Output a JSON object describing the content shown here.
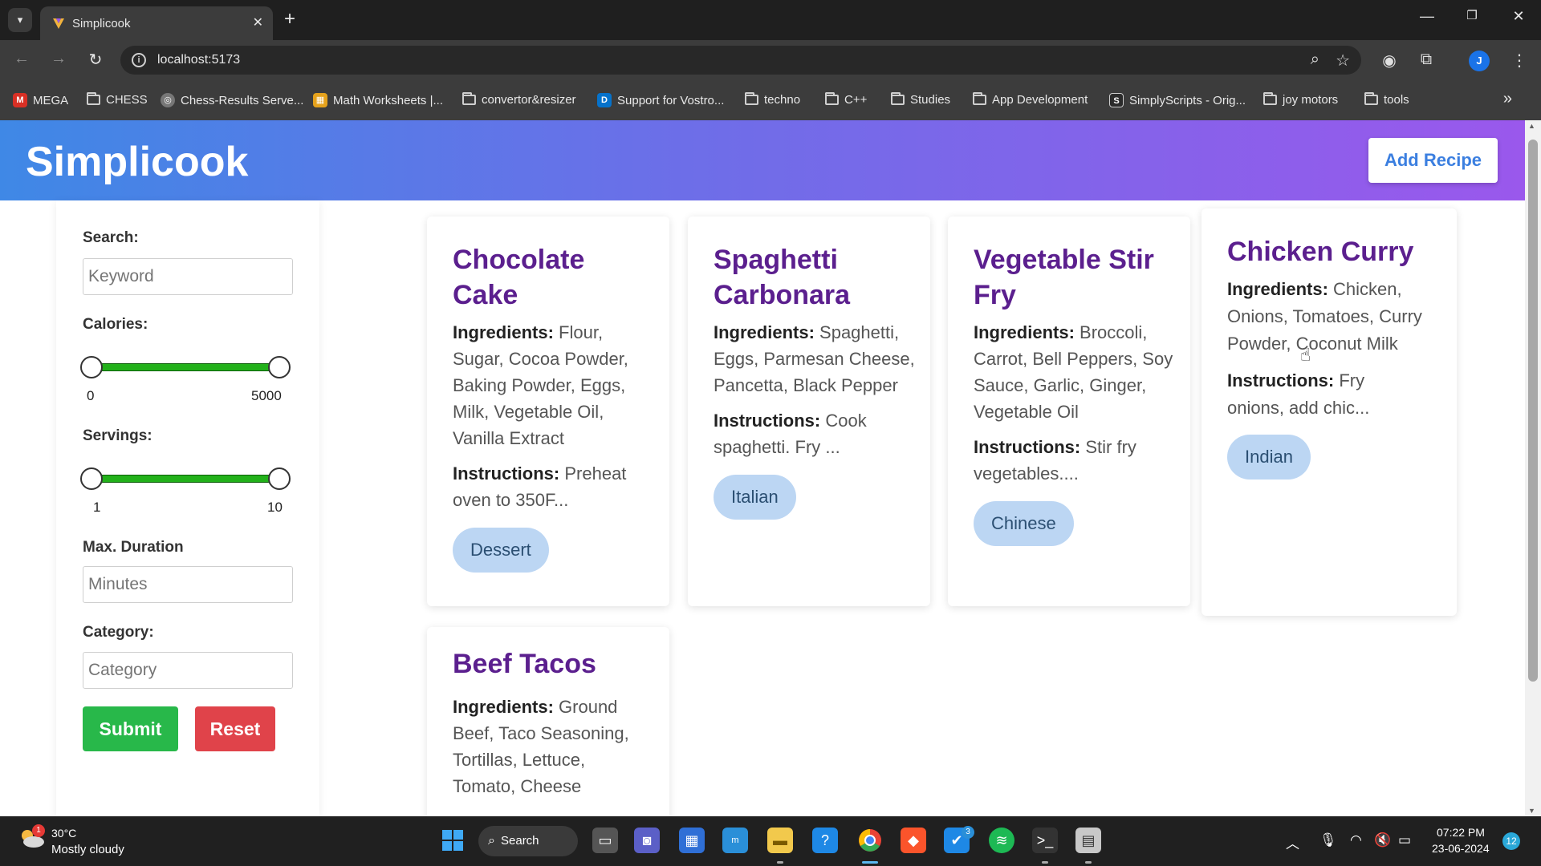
{
  "browser": {
    "tab_title": "Simplicook",
    "url": "localhost:5173",
    "profile_initial": "J",
    "bookmarks": [
      "MEGA",
      "CHESS",
      "Chess-Results Serve...",
      "Math Worksheets |...",
      "convertor&resizer",
      "Support for Vostro...",
      "techno",
      "C++",
      "Studies",
      "App Development",
      "SimplyScripts - Orig...",
      "joy motors",
      "tools"
    ]
  },
  "app": {
    "brand": "Simplicook",
    "add_recipe_label": "Add Recipe"
  },
  "filters": {
    "search_label": "Search:",
    "search_placeholder": "Keyword",
    "calories_label": "Calories:",
    "calories_min": "0",
    "calories_max": "5000",
    "servings_label": "Servings:",
    "servings_min": "1",
    "servings_max": "10",
    "duration_label": "Max. Duration",
    "duration_placeholder": "Minutes",
    "category_label": "Category:",
    "category_placeholder": "Category",
    "submit_label": "Submit",
    "reset_label": "Reset"
  },
  "recipes": [
    {
      "title_lines": [
        "Chocolate",
        "Cake"
      ],
      "ingredients_label": "Ingredients:",
      "ingredients_lines": [
        "Flour,",
        "Sugar, Cocoa Powder,",
        "Baking Powder, Eggs,",
        "Milk, Vegetable Oil,",
        "Vanilla Extract"
      ],
      "instructions_label": "Instructions:",
      "instructions_lines": [
        "Preheat",
        "oven to 350F..."
      ],
      "tag": "Dessert"
    },
    {
      "title_lines": [
        "Spaghetti",
        "Carbonara"
      ],
      "ingredients_label": "Ingredients:",
      "ingredients_lines": [
        "Spaghetti,",
        "Eggs, Parmesan Cheese,",
        "Pancetta, Black Pepper"
      ],
      "instructions_label": "Instructions:",
      "instructions_lines": [
        "Cook",
        "spaghetti. Fry ..."
      ],
      "tag": "Italian"
    },
    {
      "title_lines": [
        "Vegetable Stir",
        "Fry"
      ],
      "ingredients_label": "Ingredients:",
      "ingredients_lines": [
        "Broccoli,",
        "Carrot, Bell Peppers, Soy",
        "Sauce, Garlic, Ginger,",
        "Vegetable Oil"
      ],
      "instructions_label": "Instructions:",
      "instructions_lines": [
        "Stir fry",
        "vegetables...."
      ],
      "tag": "Chinese"
    },
    {
      "title_lines": [
        "Chicken Curry"
      ],
      "ingredients_label": "Ingredients:",
      "ingredients_lines": [
        "Chicken,",
        "Onions, Tomatoes, Curry",
        "Powder, Coconut Milk"
      ],
      "instructions_label": "Instructions:",
      "instructions_lines": [
        "Fry",
        "onions, add chic..."
      ],
      "tag": "Indian"
    },
    {
      "title_lines": [
        "Beef Tacos"
      ],
      "ingredients_label": "Ingredients:",
      "ingredients_lines": [
        "Ground",
        "Beef, Taco Seasoning,",
        "Tortillas, Lettuce,",
        "Tomato, Cheese"
      ]
    }
  ],
  "taskbar": {
    "weather_temp": "30°C",
    "weather_desc": "Mostly cloudy",
    "weather_badge": "1",
    "search_label": "Search",
    "time": "07:22 PM",
    "date": "23-06-2024",
    "notification_count": "12",
    "app_badge": "3"
  },
  "colors": {
    "header_gradient_start": "#3f88e6",
    "header_gradient_end": "#9a58ec",
    "recipe_title": "#5b1f8e",
    "submit": "#28b84a",
    "reset": "#e0434a",
    "slider_track": "#22b11a",
    "tag_bg": "#bcd6f3"
  }
}
